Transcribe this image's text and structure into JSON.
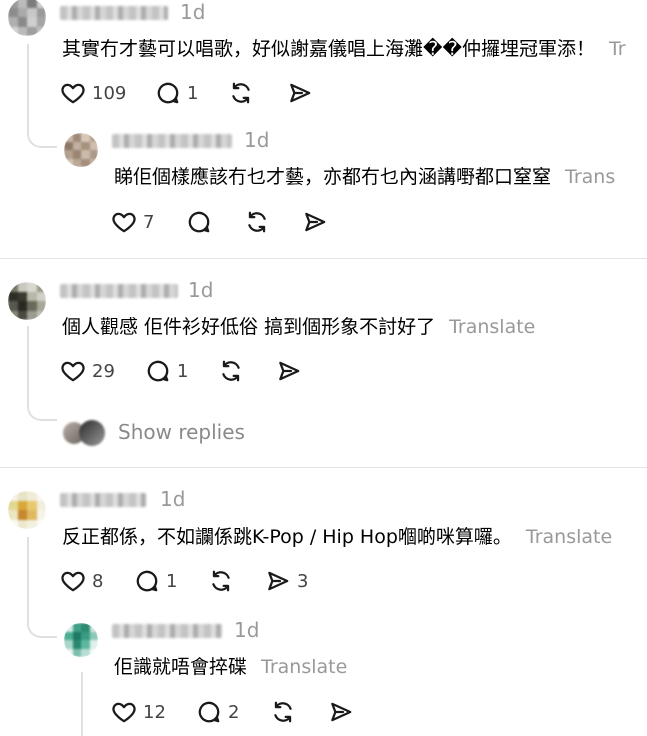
{
  "comments": [
    {
      "time": "1d",
      "text": "其實冇才藝可以唱歌，好似謝嘉儀唱上海灘��仲攞埋冠軍添！",
      "translate": "Tr",
      "likes": "109",
      "replies": "1",
      "reposts": "",
      "shares": ""
    },
    {
      "time": "1d",
      "text": "睇佢個樣應該冇乜才藝，亦都冇乜內涵講嘢都口窒窒",
      "translate": "Trans",
      "likes": "7",
      "replies": "",
      "reposts": "",
      "shares": ""
    },
    {
      "time": "1d",
      "text": "個人觀感 佢件衫好低俗 搞到個形象不討好了",
      "translate": "Translate",
      "likes": "29",
      "replies": "1",
      "reposts": "",
      "shares": ""
    },
    {
      "time": "1d",
      "text": "反正都係，不如讕係跳K-Pop / Hip Hop嗰啲咪算囉。",
      "translate": "Translate",
      "likes": "8",
      "replies": "1",
      "reposts": "",
      "shares": "3"
    },
    {
      "time": "1d",
      "text": "佢識就唔會捽碟",
      "translate": "Translate",
      "likes": "12",
      "replies": "2",
      "reposts": "",
      "shares": ""
    }
  ],
  "show_replies": "Show replies",
  "icons": {
    "like": "heart-icon",
    "reply": "comment-bubble-icon",
    "repost": "repost-icon",
    "share": "send-icon"
  },
  "colors": {
    "meta_gray": "#999999",
    "divider": "#e4e4e4"
  }
}
